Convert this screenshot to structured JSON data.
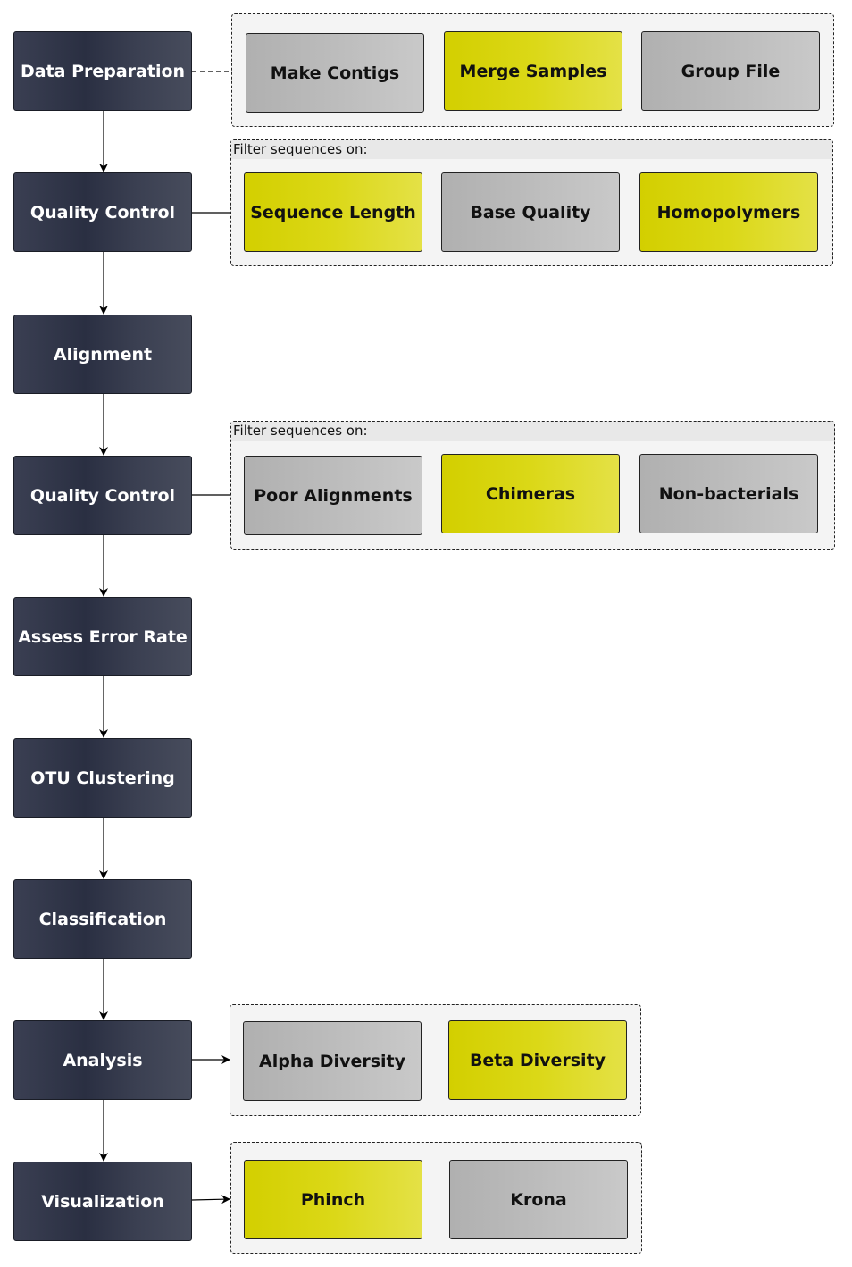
{
  "steps": [
    "Data Preparation",
    "Quality Control",
    "Alignment",
    "Quality Control",
    "Assess Error Rate",
    "OTU Clustering",
    "Classification",
    "Analysis",
    "Visualization"
  ],
  "groups": {
    "data_preparation": {
      "items": [
        {
          "label": "Make Contigs",
          "color": "gray"
        },
        {
          "label": "Merge Samples",
          "color": "yellow"
        },
        {
          "label": "Group File",
          "color": "gray"
        }
      ]
    },
    "quality_control_1": {
      "label": "Filter sequences on:",
      "items": [
        {
          "label": "Sequence Length",
          "color": "yellow"
        },
        {
          "label": "Base Quality",
          "color": "gray"
        },
        {
          "label": "Homopolymers",
          "color": "yellow"
        }
      ]
    },
    "quality_control_2": {
      "label": "Filter sequences on:",
      "items": [
        {
          "label": "Poor Alignments",
          "color": "gray"
        },
        {
          "label": "Chimeras",
          "color": "yellow"
        },
        {
          "label": "Non-bacterials",
          "color": "gray"
        }
      ]
    },
    "analysis": {
      "items": [
        {
          "label": "Alpha Diversity",
          "color": "gray"
        },
        {
          "label": "Beta Diversity",
          "color": "yellow"
        }
      ]
    },
    "visualization": {
      "items": [
        {
          "label": "Phinch",
          "color": "yellow"
        },
        {
          "label": "Krona",
          "color": "gray"
        }
      ]
    }
  },
  "colors": {
    "step": "#2a2f42",
    "gray": "#bcbcbc",
    "yellow": "#dbd817",
    "group_bg": "#f4f4f4"
  }
}
